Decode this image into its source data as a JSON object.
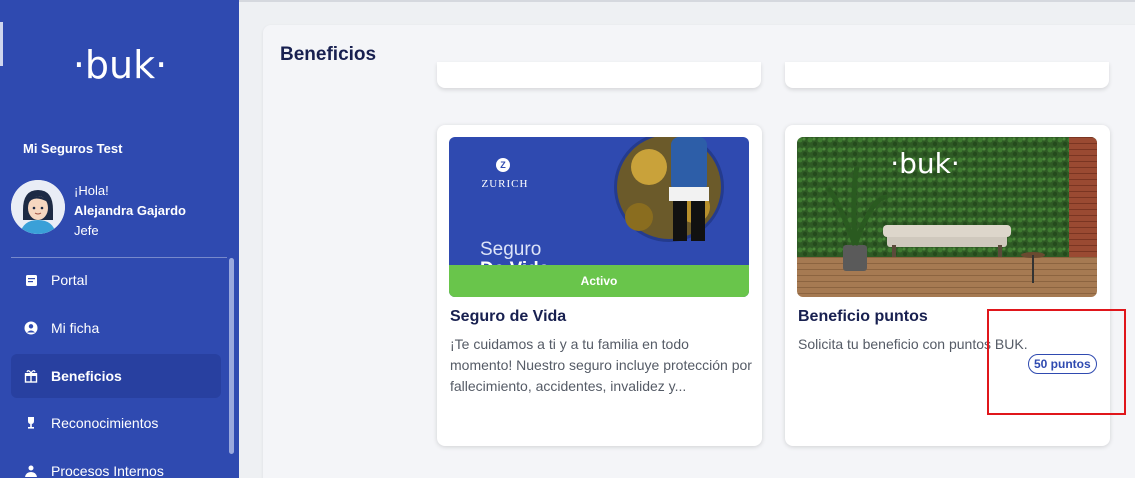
{
  "sidebar": {
    "logo_text": "·buk·",
    "company": "Mi Seguros Test",
    "user": {
      "greeting": "¡Hola!",
      "name": "Alejandra Gajardo",
      "role": "Jefe"
    },
    "nav": [
      {
        "label": "Portal",
        "icon": "document-icon"
      },
      {
        "label": "Mi ficha",
        "icon": "user-circle-icon"
      },
      {
        "label": "Beneficios",
        "icon": "gift-icon",
        "active": true
      },
      {
        "label": "Reconocimientos",
        "icon": "trophy-icon"
      },
      {
        "label": "Procesos Internos",
        "icon": "user-process-icon"
      }
    ]
  },
  "main": {
    "title": "Beneficios",
    "cards": [
      {
        "title": "Seguro de Vida",
        "description": "¡Te cuidamos a ti y a tu familia en todo momento! Nuestro seguro incluye protección por fallecimiento, accidentes, invalidez y...",
        "status": "Activo",
        "image": {
          "brand": "ZURICH",
          "headline": "Seguro",
          "headline2": "De Vida"
        }
      },
      {
        "title": "Beneficio puntos",
        "description": "Solicita tu beneficio con puntos BUK.",
        "points": "50 puntos",
        "image": {
          "brand": "·buk·"
        }
      }
    ]
  },
  "colors": {
    "sidebar": "#2f4ab0",
    "status_active": "#69c54b",
    "highlight": "#e0161b"
  }
}
